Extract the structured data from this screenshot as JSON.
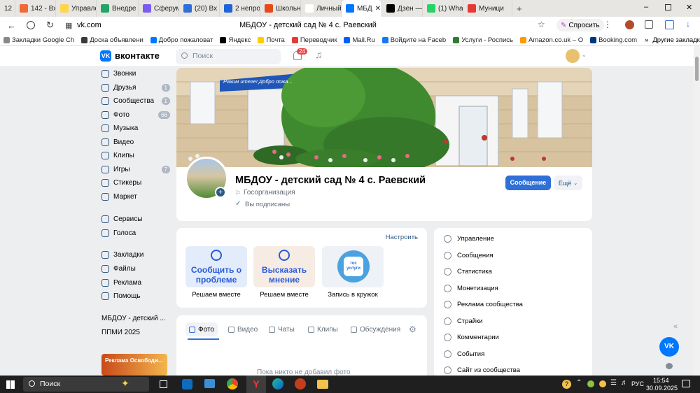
{
  "tabs": [
    {
      "label": "12",
      "icon_color": "#e8e6e3"
    },
    {
      "label": "142 - Вх",
      "icon_color": "#f06a35"
    },
    {
      "label": "Управле",
      "icon_color": "#ffd54a"
    },
    {
      "label": "Внедре",
      "icon_color": "#23a566"
    },
    {
      "label": "Сферум",
      "icon_color": "#7b5cf0"
    },
    {
      "label": "(20) Вх",
      "icon_color": "#2f6fd6"
    },
    {
      "label": "2 непро",
      "icon_color": "#1e64d8"
    },
    {
      "label": "Школьн",
      "icon_color": "#e64a19"
    },
    {
      "label": "Личный",
      "icon_color": "#ffffff"
    },
    {
      "label": "МБД",
      "icon_color": "#0077ff"
    },
    {
      "label": "Дзен —",
      "icon_color": "#000000"
    },
    {
      "label": "(1) Wha",
      "icon_color": "#25d366"
    },
    {
      "label": "Муници",
      "icon_color": "#e53935"
    }
  ],
  "address": {
    "url": "vk.com",
    "title": "МБДОУ - детский сад № 4 с. Раевский",
    "ask_label": "Спросить"
  },
  "bookmarks": [
    {
      "label": "Закладки Google Ch",
      "color": "#888888"
    },
    {
      "label": "Доска объявлени",
      "color": "#3a3a3a"
    },
    {
      "label": "Добро пожаловат",
      "color": "#0077ff"
    },
    {
      "label": "Яндекс",
      "color": "#000000"
    },
    {
      "label": "Почта",
      "color": "#ffcc00"
    },
    {
      "label": "Переводчик",
      "color": "#e53935"
    },
    {
      "label": "Mail.Ru",
      "color": "#005ff9"
    },
    {
      "label": "Войдите на Faceb",
      "color": "#1877f2"
    },
    {
      "label": "Услуги - Роспись",
      "color": "#2e7d32"
    },
    {
      "label": "Amazon.co.uk – O",
      "color": "#ff9900"
    },
    {
      "label": "Booking.com",
      "color": "#003580"
    }
  ],
  "other_bookmarks": "Другие закладки",
  "vk": {
    "logo": "вконтакте",
    "search_placeholder": "Поиск",
    "notif_count": "24"
  },
  "sidebar": [
    {
      "label": "Звонки",
      "badge": ""
    },
    {
      "label": "Друзья",
      "badge": "1"
    },
    {
      "label": "Сообщества",
      "badge": "1"
    },
    {
      "label": "Фото",
      "badge": "66"
    },
    {
      "label": "Музыка",
      "badge": ""
    },
    {
      "label": "Видео",
      "badge": ""
    },
    {
      "label": "Клипы",
      "badge": ""
    },
    {
      "label": "Игры",
      "badge": "7"
    },
    {
      "label": "Стикеры",
      "badge": ""
    },
    {
      "label": "Маркет",
      "badge": ""
    },
    {
      "label": "Сервисы",
      "badge": ""
    },
    {
      "label": "Голоса",
      "badge": ""
    },
    {
      "label": "Закладки",
      "badge": ""
    },
    {
      "label": "Файлы",
      "badge": ""
    },
    {
      "label": "Реклама",
      "badge": ""
    },
    {
      "label": "Помощь",
      "badge": ""
    },
    {
      "label": "МБДОУ - детский ...",
      "badge": ""
    },
    {
      "label": "ППМИ 2025",
      "badge": ""
    }
  ],
  "cover": {
    "banner_text": "Рахим итеге! Добро пожа..."
  },
  "group": {
    "name": "МБДОУ - детский сад № 4 с. Раевский",
    "type": "Госорганизация",
    "subscribed": "Вы подписаны",
    "message_btn": "Сообщение",
    "more_btn": "Ещё"
  },
  "widgets": {
    "configure": "Настроить",
    "items": [
      {
        "title": "Сообщить о проблеме",
        "caption": "Решаем вместе",
        "bg": "#e3ecfa",
        "color": "#2a5bd7"
      },
      {
        "title": "Высказать мнение",
        "caption": "Решаем вместе",
        "bg": "#f7ece4",
        "color": "#2a5bd7"
      },
      {
        "title": "гос услуги",
        "caption": "Запись в кружок",
        "bg": "#eef1f5",
        "color": "#2f6fd6"
      }
    ]
  },
  "mtabs": [
    "Фото",
    "Видео",
    "Чаты",
    "Клипы",
    "Обсуждения"
  ],
  "empty_text": "Пока никто не добавил фото",
  "right_menu": [
    "Управление",
    "Сообщения",
    "Статистика",
    "Монетизация",
    "Реклама сообщества",
    "Страйки",
    "Комментарии",
    "События",
    "Сайт из сообщества"
  ],
  "promo": {
    "text": "Реклама Освободи..."
  },
  "taskbar": {
    "search": "Поиск",
    "lang": "РУС",
    "time": "15:54",
    "date": "30.09.2025"
  }
}
